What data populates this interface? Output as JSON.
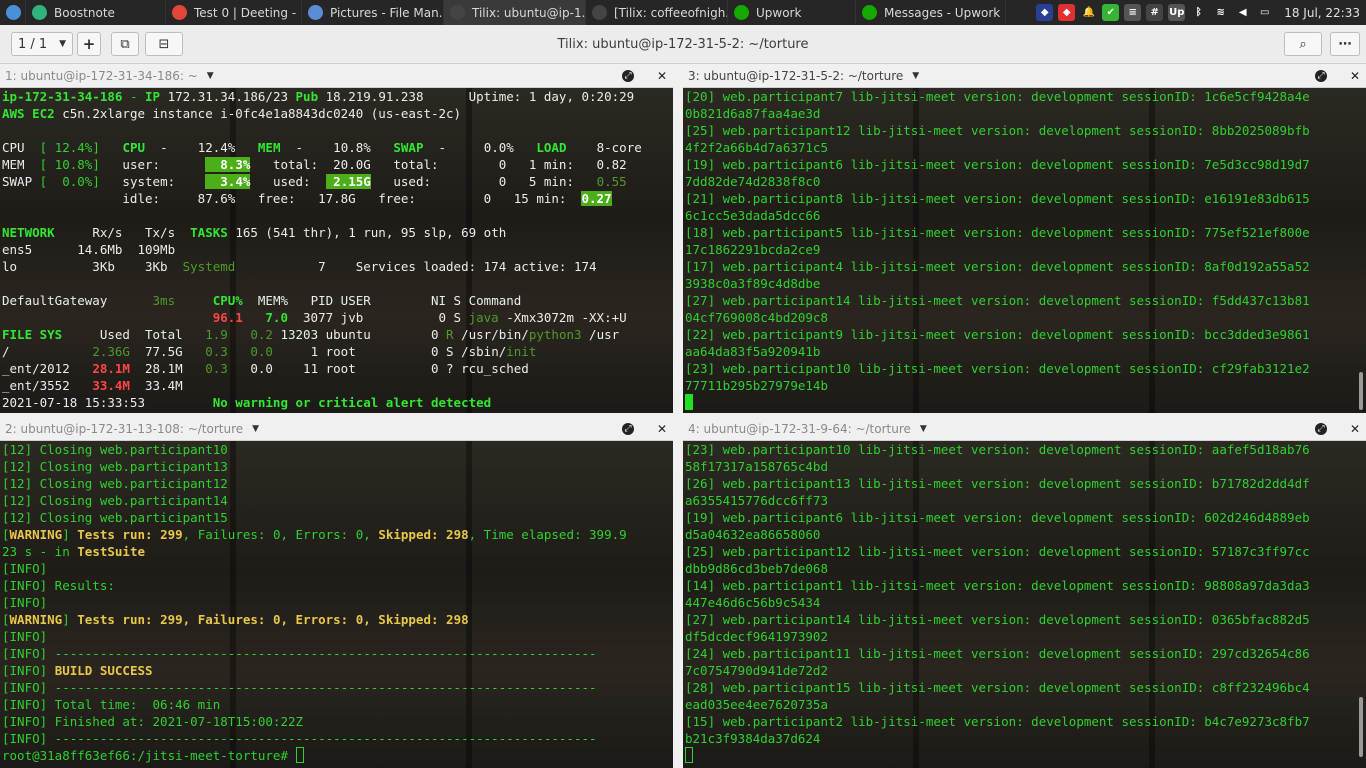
{
  "topbar": {
    "items": [
      {
        "label": "",
        "icon": "desktop-icon",
        "color": "#4a90d9"
      },
      {
        "label": "Boostnote",
        "icon": "boostnote-icon",
        "color": "#2fb47c"
      },
      {
        "label": "Test 0 | Deeting - ...",
        "icon": "chrome-icon",
        "color": "#e4453a"
      },
      {
        "label": "Pictures - File Man...",
        "icon": "folder-icon",
        "color": "#5b8dd6"
      },
      {
        "label": "Tilix: ubuntu@ip-1...",
        "icon": "terminal-icon",
        "color": "#444444",
        "active": true
      },
      {
        "label": "[Tilix: coffeeofnigh...",
        "icon": "terminal-icon",
        "color": "#444444"
      },
      {
        "label": "Upwork",
        "icon": "upwork-icon",
        "color": "#14a800"
      },
      {
        "label": "Messages - Upwork",
        "icon": "upwork-icon",
        "color": "#14a800"
      }
    ],
    "clock": "18 Jul, 22:33",
    "tray": [
      {
        "icon": "app-icon",
        "color": "#2a3f8f",
        "glyph": "◆"
      },
      {
        "icon": "git-icon",
        "color": "#e03030",
        "glyph": "◆"
      },
      {
        "icon": "bell-icon",
        "color": "transparent",
        "glyph": "🔔"
      },
      {
        "icon": "check-icon",
        "color": "#35b535",
        "glyph": "✔"
      },
      {
        "icon": "notes-icon",
        "color": "#555555",
        "glyph": "≡"
      },
      {
        "icon": "slack-icon",
        "color": "#444444",
        "glyph": "#"
      },
      {
        "icon": "upwork-icon",
        "color": "#555555",
        "glyph": "Up"
      },
      {
        "icon": "bluetooth-icon",
        "color": "transparent",
        "glyph": "ᛒ"
      },
      {
        "icon": "wifi-icon",
        "color": "transparent",
        "glyph": "≋"
      },
      {
        "icon": "volume-icon",
        "color": "transparent",
        "glyph": "◀"
      },
      {
        "icon": "battery-icon",
        "color": "transparent",
        "glyph": "▭"
      }
    ]
  },
  "header": {
    "session_selector": "1 / 1",
    "title": "Tilix: ubuntu@ip-172-31-5-2: ~/torture"
  },
  "panes": {
    "p1": {
      "title": "1: ubuntu@ip-172-31-34-186: ~",
      "active": false
    },
    "p2": {
      "title": "2: ubuntu@ip-172-31-13-108: ~/torture",
      "active": false
    },
    "p3": {
      "title": "3: ubuntu@ip-172-31-5-2: ~/torture",
      "active": true
    },
    "p4": {
      "title": "4: ubuntu@ip-172-31-9-64: ~/torture",
      "active": false
    }
  },
  "term1": [
    [
      [
        "ip-172-31-34-186",
        "bg"
      ],
      [
        " - ",
        "g"
      ],
      [
        "IP",
        "bg"
      ],
      [
        " 172.31.34.186/23 ",
        "w"
      ],
      [
        "Pub",
        "bg"
      ],
      [
        " 18.219.91.238      Uptime: 1 day, 0:20:29",
        "w"
      ]
    ],
    [
      [
        "AWS EC2",
        "bg"
      ],
      [
        " c5n.2xlarge instance i-0fc4e1a8843dc0240 (us-east-2c)",
        "w"
      ]
    ],
    [
      [
        "",
        ""
      ]
    ],
    [
      [
        "CPU  ",
        "w"
      ],
      [
        "[ 12.4%]",
        "g"
      ],
      [
        "   ",
        "w"
      ],
      [
        "CPU",
        "bg"
      ],
      [
        "  -    12.4%   ",
        "w"
      ],
      [
        "MEM",
        "bg"
      ],
      [
        "  -    10.8%   ",
        "w"
      ],
      [
        "SWAP",
        "bg"
      ],
      [
        "  -     0.0%   ",
        "w"
      ],
      [
        "LOAD",
        "bg"
      ],
      [
        "    8-core",
        "w"
      ]
    ],
    [
      [
        "MEM  ",
        "w"
      ],
      [
        "[ 10.8%]",
        "g"
      ],
      [
        "   user:      ",
        "w"
      ],
      [
        "  8.3%",
        "hl"
      ],
      [
        "   total:  20.0G   total:        0   1 min:   0.82",
        "w"
      ]
    ],
    [
      [
        "SWAP ",
        "w"
      ],
      [
        "[  0.0%]",
        "g"
      ],
      [
        "   system:    ",
        "w"
      ],
      [
        "  3.4%",
        "hl"
      ],
      [
        "   used:  ",
        "w"
      ],
      [
        " 2.15G",
        "hl"
      ],
      [
        "   used:         0   5 min:   ",
        "w"
      ],
      [
        "0.55",
        "dim"
      ]
    ],
    [
      [
        "                idle:     87.6%   free:   17.8G   free:         0   15 min:  ",
        "w"
      ],
      [
        "0.27",
        "hl"
      ]
    ],
    [
      [
        "",
        ""
      ]
    ],
    [
      [
        "NETWORK",
        "bg"
      ],
      [
        "     Rx/s   Tx/s  ",
        "w"
      ],
      [
        "TASKS",
        "bg"
      ],
      [
        " 165 (541 thr), 1 run, 95 slp, 69 oth",
        "w"
      ]
    ],
    [
      [
        "ens5      14.6Mb  109Mb",
        "w"
      ]
    ],
    [
      [
        "lo          3Kb    3Kb  ",
        "w"
      ],
      [
        "Systemd",
        "dim"
      ],
      [
        "           7    Services loaded: 174 active: 174",
        "w"
      ]
    ],
    [
      [
        "",
        ""
      ]
    ],
    [
      [
        "DefaultGateway      ",
        "w"
      ],
      [
        "3ms",
        "dim"
      ],
      [
        "     ",
        "w"
      ],
      [
        "CPU%",
        "bg"
      ],
      [
        "  MEM%   PID USER        NI S Command",
        "w"
      ]
    ],
    [
      [
        "                            ",
        "w"
      ],
      [
        "96.1",
        "r"
      ],
      [
        "   ",
        "w"
      ],
      [
        "7.0",
        "bg"
      ],
      [
        "  3077 jvb          0 S ",
        "w"
      ],
      [
        "java",
        "dim"
      ],
      [
        " -Xmx3072m -XX:+U",
        "w"
      ]
    ],
    [
      [
        "FILE SYS",
        "bg"
      ],
      [
        "     Used  Total   ",
        "w"
      ],
      [
        "1.9",
        "dim"
      ],
      [
        "   ",
        "w"
      ],
      [
        "0.2",
        "dim"
      ],
      [
        " 13203 ubuntu        0 ",
        "w"
      ],
      [
        "R",
        "dim"
      ],
      [
        " /usr/bin/",
        "w"
      ],
      [
        "python3",
        "dim"
      ],
      [
        " /usr",
        "w"
      ]
    ],
    [
      [
        "/           ",
        "w"
      ],
      [
        "2.36G",
        "dim"
      ],
      [
        "  77.5G   ",
        "w"
      ],
      [
        "0.3",
        "dim"
      ],
      [
        "   ",
        "w"
      ],
      [
        "0.0",
        "dim"
      ],
      [
        "     1 root          0 S /sbin/",
        "w"
      ],
      [
        "init",
        "dim"
      ]
    ],
    [
      [
        "_ent/2012   ",
        "w"
      ],
      [
        "28.1M",
        "r"
      ],
      [
        "  28.1M   ",
        "w"
      ],
      [
        "0.3",
        "dim"
      ],
      [
        "   0.0    11 root          0 ? rcu_sched",
        "w"
      ]
    ],
    [
      [
        "_ent/3552   ",
        "w"
      ],
      [
        "33.4M",
        "r"
      ],
      [
        "  33.4M",
        "w"
      ]
    ],
    [
      [
        "2021-07-18 15:33:53         ",
        "w"
      ],
      [
        "No warning or critical alert detected",
        "bg"
      ]
    ]
  ],
  "term3": [
    [
      [
        "[20] web.participant7 lib-jitsi-meet version: development sessionID: 1c6e5cf9428a4e",
        "g"
      ]
    ],
    [
      [
        "0b821d6a87faa4ae3d",
        "g"
      ]
    ],
    [
      [
        "[25] web.participant12 lib-jitsi-meet version: development sessionID: 8bb2025089bfb",
        "g"
      ]
    ],
    [
      [
        "4f2f2a66b4d7a6371c5",
        "g"
      ]
    ],
    [
      [
        "[19] web.participant6 lib-jitsi-meet version: development sessionID: 7e5d3cc98d19d7",
        "g"
      ]
    ],
    [
      [
        "7dd82de74d2838f8c0",
        "g"
      ]
    ],
    [
      [
        "[21] web.participant8 lib-jitsi-meet version: development sessionID: e16191e83db615",
        "g"
      ]
    ],
    [
      [
        "6c1cc5e3dada5dcc66",
        "g"
      ]
    ],
    [
      [
        "[18] web.participant5 lib-jitsi-meet version: development sessionID: 775ef521ef800e",
        "g"
      ]
    ],
    [
      [
        "17c1862291bcda2ce9",
        "g"
      ]
    ],
    [
      [
        "[17] web.participant4 lib-jitsi-meet version: development sessionID: 8af0d192a55a52",
        "g"
      ]
    ],
    [
      [
        "3938c0a3f89c4d8dbe",
        "g"
      ]
    ],
    [
      [
        "[27] web.participant14 lib-jitsi-meet version: development sessionID: f5dd437c13b81",
        "g"
      ]
    ],
    [
      [
        "04cf769008c4bd209c8",
        "g"
      ]
    ],
    [
      [
        "[22] web.participant9 lib-jitsi-meet version: development sessionID: bcc3dded3e9861",
        "g"
      ]
    ],
    [
      [
        "aa64da83f5a920941b",
        "g"
      ]
    ],
    [
      [
        "[23] web.participant10 lib-jitsi-meet version: development sessionID: cf29fab3121e2",
        "g"
      ]
    ],
    [
      [
        "77711b295b27979e14b",
        "g"
      ]
    ],
    [
      [
        "",
        "cursor"
      ]
    ]
  ],
  "term2": [
    [
      [
        "[12] Closing web.participant10",
        "g"
      ]
    ],
    [
      [
        "[12] Closing web.participant13",
        "g"
      ]
    ],
    [
      [
        "[12] Closing web.participant12",
        "g"
      ]
    ],
    [
      [
        "[12] Closing web.participant14",
        "g"
      ]
    ],
    [
      [
        "[12] Closing web.participant15",
        "g"
      ]
    ],
    [
      [
        "[",
        "g"
      ],
      [
        "WARNING",
        "y"
      ],
      [
        "] ",
        "g"
      ],
      [
        "Tests run: 299",
        "y"
      ],
      [
        ", Failures: 0, Errors: 0, ",
        "g"
      ],
      [
        "Skipped: 298",
        "y"
      ],
      [
        ", Time elapsed: 399.9",
        "g"
      ]
    ],
    [
      [
        "23 s - in ",
        "g"
      ],
      [
        "TestSuite",
        "y"
      ]
    ],
    [
      [
        "[INFO]",
        "g"
      ]
    ],
    [
      [
        "[INFO] Results:",
        "g"
      ]
    ],
    [
      [
        "[INFO]",
        "g"
      ]
    ],
    [
      [
        "[",
        "g"
      ],
      [
        "WARNING",
        "y"
      ],
      [
        "] ",
        "g"
      ],
      [
        "Tests run: 299, Failures: 0, Errors: 0, Skipped: 298",
        "y"
      ]
    ],
    [
      [
        "[INFO]",
        "g"
      ]
    ],
    [
      [
        "[INFO] ------------------------------------------------------------------------",
        "g"
      ]
    ],
    [
      [
        "[INFO] ",
        "g"
      ],
      [
        "BUILD SUCCESS",
        "y"
      ]
    ],
    [
      [
        "[INFO] ------------------------------------------------------------------------",
        "g"
      ]
    ],
    [
      [
        "[INFO] Total time:  06:46 min",
        "g"
      ]
    ],
    [
      [
        "[INFO] Finished at: 2021-07-18T15:00:22Z",
        "g"
      ]
    ],
    [
      [
        "[INFO] ------------------------------------------------------------------------",
        "g"
      ]
    ],
    [
      [
        "root@31a8ff63ef66:/jitsi-meet-torture# ",
        "g"
      ],
      [
        "",
        "cursor o"
      ]
    ]
  ],
  "term4": [
    [
      [
        "[23] web.participant10 lib-jitsi-meet version: development sessionID: aafef5d18ab76",
        "g"
      ]
    ],
    [
      [
        "58f17317a158765c4bd",
        "g"
      ]
    ],
    [
      [
        "[26] web.participant13 lib-jitsi-meet version: development sessionID: b71782d2dd4df",
        "g"
      ]
    ],
    [
      [
        "a6355415776dcc6ff73",
        "g"
      ]
    ],
    [
      [
        "[19] web.participant6 lib-jitsi-meet version: development sessionID: 602d246d4889eb",
        "g"
      ]
    ],
    [
      [
        "d5a04632ea86658060",
        "g"
      ]
    ],
    [
      [
        "[25] web.participant12 lib-jitsi-meet version: development sessionID: 57187c3ff97cc",
        "g"
      ]
    ],
    [
      [
        "dbb9d86cd3beb7de068",
        "g"
      ]
    ],
    [
      [
        "[14] web.participant1 lib-jitsi-meet version: development sessionID: 98808a97da3da3",
        "g"
      ]
    ],
    [
      [
        "447e46d6c56b9c5434",
        "g"
      ]
    ],
    [
      [
        "[27] web.participant14 lib-jitsi-meet version: development sessionID: 0365bfac882d5",
        "g"
      ]
    ],
    [
      [
        "df5dcdecf9641973902",
        "g"
      ]
    ],
    [
      [
        "[24] web.participant11 lib-jitsi-meet version: development sessionID: 297cd32654c86",
        "g"
      ]
    ],
    [
      [
        "7c0754790d941de72d2",
        "g"
      ]
    ],
    [
      [
        "[28] web.participant15 lib-jitsi-meet version: development sessionID: c8ff232496bc4",
        "g"
      ]
    ],
    [
      [
        "ead035ee4ee7620735a",
        "g"
      ]
    ],
    [
      [
        "[15] web.participant2 lib-jitsi-meet version: development sessionID: b4c7e9273c8fb7",
        "g"
      ]
    ],
    [
      [
        "b21c3f9384da37d624",
        "g"
      ]
    ],
    [
      [
        "",
        "cursor o"
      ]
    ]
  ]
}
